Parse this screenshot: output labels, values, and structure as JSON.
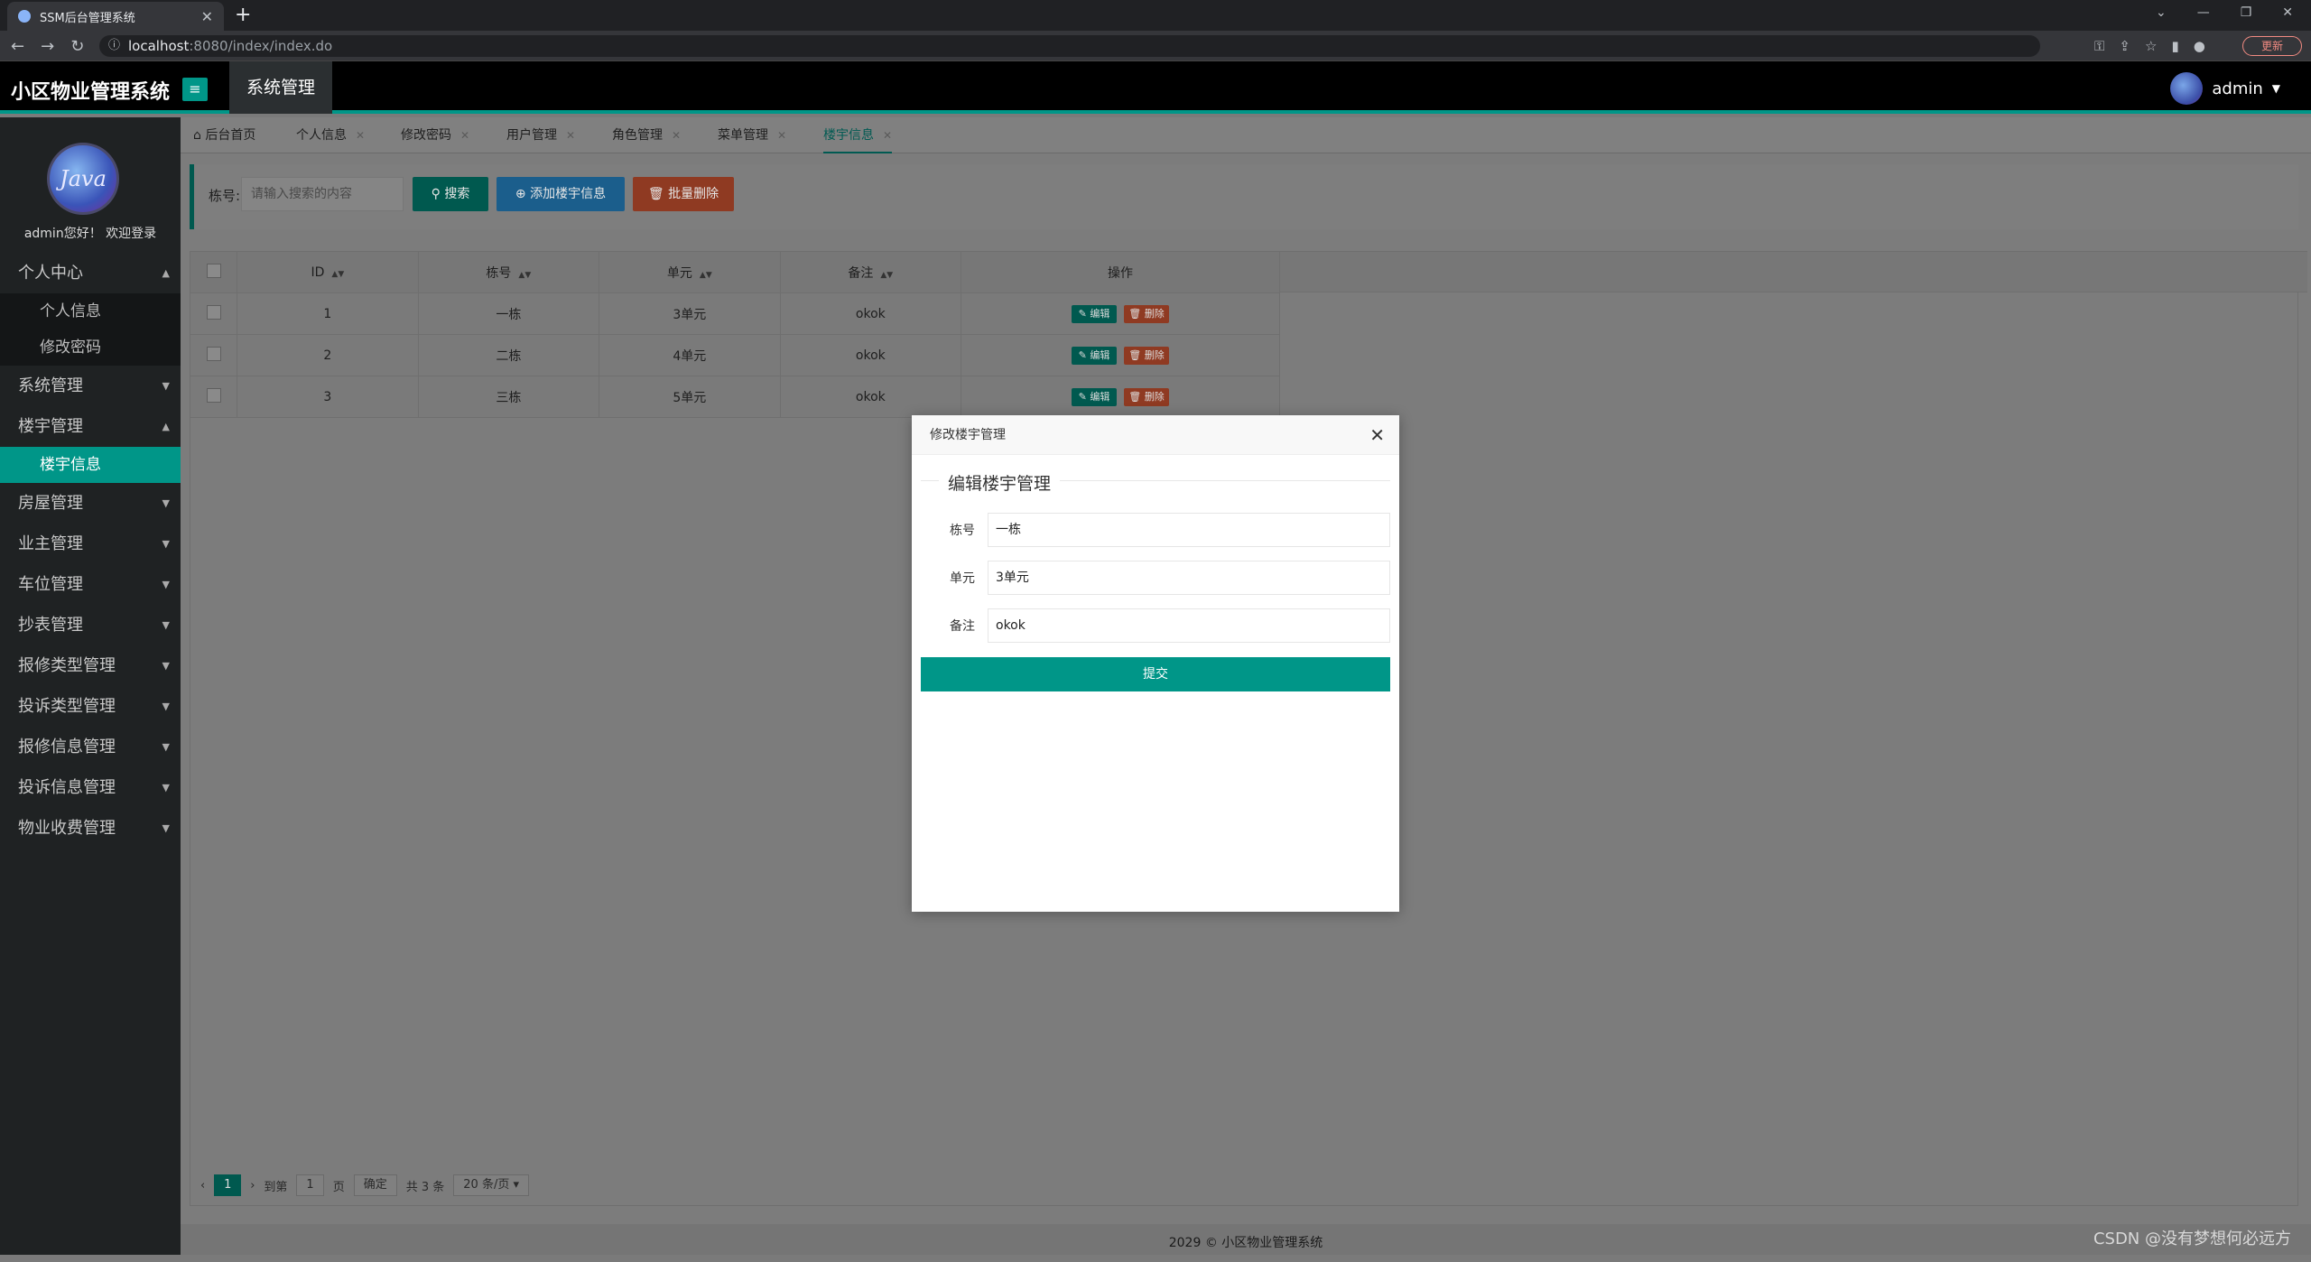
{
  "browser": {
    "tab_title": "SSM后台管理系统",
    "url_host": "localhost",
    "url_path": ":8080/index/index.do",
    "update_label": "更新"
  },
  "header": {
    "logo": "小区物业管理系统",
    "top_nav": "系统管理",
    "username": "admin"
  },
  "sidebar": {
    "avatar_text": "Java",
    "welcome": "admin您好！ 欢迎登录",
    "menu": [
      {
        "label": "个人中心",
        "expanded": true
      },
      {
        "label": "个人信息",
        "sub": true
      },
      {
        "label": "修改密码",
        "sub": true
      },
      {
        "label": "系统管理"
      },
      {
        "label": "楼宇管理",
        "expanded": true
      },
      {
        "label": "楼宇信息",
        "sub": true,
        "active": true
      },
      {
        "label": "房屋管理"
      },
      {
        "label": "业主管理"
      },
      {
        "label": "车位管理"
      },
      {
        "label": "抄表管理"
      },
      {
        "label": "报修类型管理"
      },
      {
        "label": "投诉类型管理"
      },
      {
        "label": "报修信息管理"
      },
      {
        "label": "投诉信息管理"
      },
      {
        "label": "物业收费管理"
      }
    ]
  },
  "page_tabs": [
    {
      "label": "后台首页",
      "icon": "home-icon"
    },
    {
      "label": "个人信息"
    },
    {
      "label": "修改密码"
    },
    {
      "label": "用户管理"
    },
    {
      "label": "角色管理"
    },
    {
      "label": "菜单管理"
    },
    {
      "label": "楼宇信息",
      "active": true
    }
  ],
  "search": {
    "label": "栋号:",
    "placeholder": "请输入搜索的内容",
    "search_btn": "搜索",
    "add_btn": "添加楼宇信息",
    "batch_delete_btn": "批量删除"
  },
  "table": {
    "headers": [
      "ID",
      "栋号",
      "单元",
      "备注",
      "操作"
    ],
    "rows": [
      {
        "id": "1",
        "building": "一栋",
        "unit": "3单元",
        "note": "okok"
      },
      {
        "id": "2",
        "building": "二栋",
        "unit": "4单元",
        "note": "okok"
      },
      {
        "id": "3",
        "building": "三栋",
        "unit": "5单元",
        "note": "okok"
      }
    ],
    "edit_label": "编辑",
    "delete_label": "删除"
  },
  "pager": {
    "current_page": "1",
    "goto_label": "到第",
    "goto_value": "1",
    "page_unit": "页",
    "confirm": "确定",
    "total": "共 3 条",
    "page_size": "20 条/页"
  },
  "footer": "2029 © 小区物业管理系统",
  "modal": {
    "title": "修改楼宇管理",
    "legend": "编辑楼宇管理",
    "fields": [
      {
        "label": "栋号",
        "value": "一栋"
      },
      {
        "label": "单元",
        "value": "3单元"
      },
      {
        "label": "备注",
        "value": "okok"
      }
    ],
    "submit": "提交"
  },
  "watermark": "CSDN @没有梦想何必远方"
}
